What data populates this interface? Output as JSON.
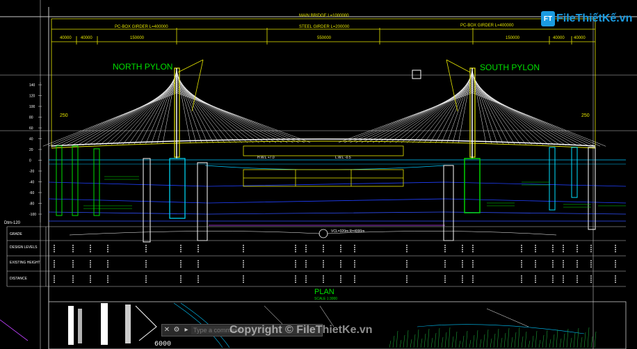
{
  "drawing": {
    "dims_top": {
      "main_bridge": "MAIN BRIDGE L=1000000",
      "pc_box_left": "PC-BOX GIRDER L=400000",
      "steel_girder": "STEEL GIRDER L=200000",
      "pc_box_right": "PC-BOX GIRDER L=400000",
      "d1": "40000",
      "d2": "40000",
      "d3": "150000",
      "d4": "550000",
      "d5": "150000",
      "d6": "40000",
      "d7": "40000"
    },
    "north_pylon": "NORTH PYLON",
    "south_pylon": "SOUTH PYLON",
    "left_tick": "250",
    "right_tick": "250",
    "y_axis": [
      "140",
      "120",
      "100",
      "80",
      "60",
      "40",
      "20",
      "0",
      "-20",
      "-40",
      "-60",
      "-80",
      "-100"
    ],
    "datum": "Dtm-120",
    "hwl": "H.W.L +7.0",
    "lwl": "L.W.L -0.5",
    "row_labels": [
      "GRADE",
      "DESIGN LEVELS",
      "EXISTING HEIGHT",
      "DISTANCE"
    ],
    "curve_note": "VCL=320m R=4000m",
    "plan_title": "PLAN",
    "plan_scale": "SCALE 1:3000"
  },
  "logo": {
    "badge": "FT",
    "text": "FileThiếtKế.vn"
  },
  "command": {
    "placeholder": "Type a command"
  },
  "watermark": "Copyright © FileThietKe.vn",
  "status": {
    "coords": "6000"
  }
}
